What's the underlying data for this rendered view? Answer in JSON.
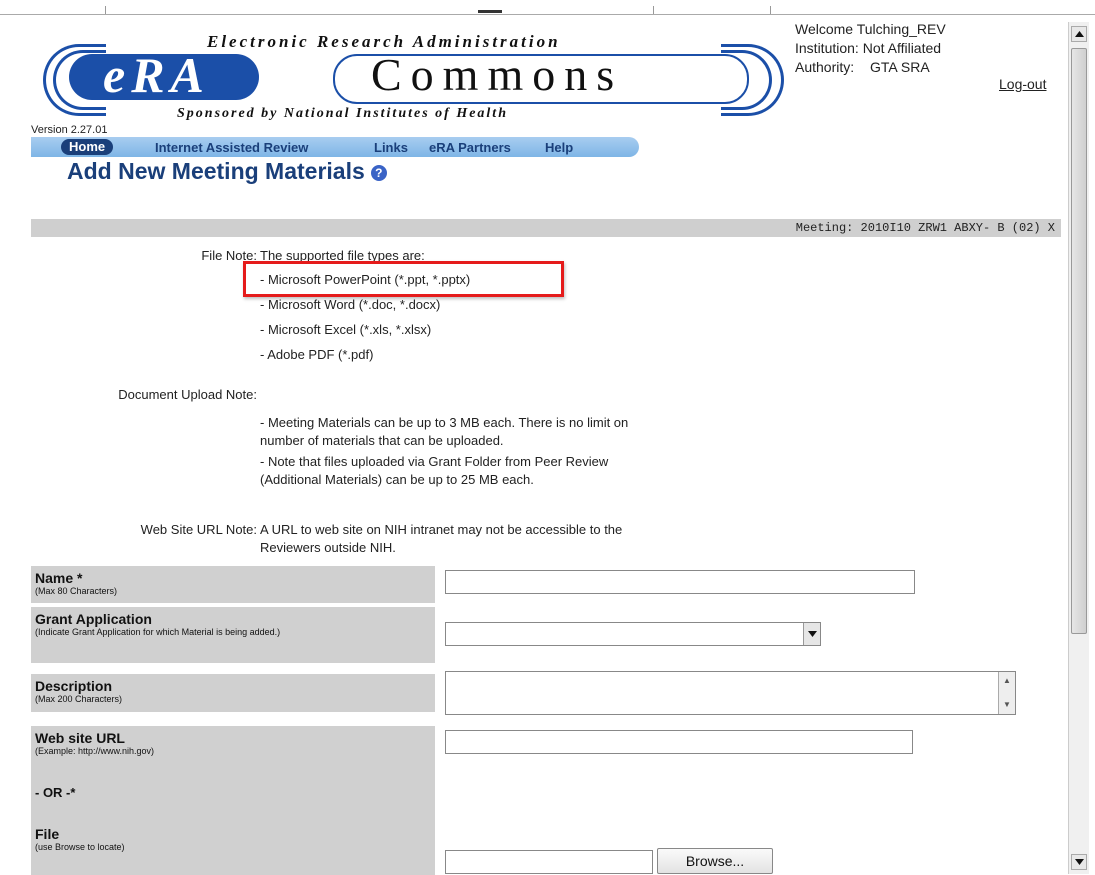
{
  "header": {
    "logo_tagline_top": "Electronic Research Administration",
    "logo_era": "eRA",
    "logo_commons": "Commons",
    "logo_tagline_bottom": "Sponsored by National Institutes of Health",
    "welcome": "Welcome Tulching_REV",
    "institution": "Institution: Not Affiliated",
    "authority_label": "Authority:",
    "authority_role": "GTA SRA",
    "logout": "Log-out",
    "version": "Version 2.27.01"
  },
  "nav": {
    "items": [
      {
        "label": "Home"
      },
      {
        "label": "Internet Assisted Review"
      },
      {
        "label": "Links"
      },
      {
        "label": "eRA Partners"
      },
      {
        "label": "Help"
      }
    ]
  },
  "page": {
    "title": "Add New Meeting Materials",
    "meeting": "Meeting: 2010I10 ZRW1 ABXY- B (02) X"
  },
  "notes": {
    "file_note_label": "File Note:",
    "file_note_intro": "The supported file types are:",
    "file_types": [
      "- Microsoft PowerPoint (*.ppt, *.pptx)",
      "- Microsoft Word (*.doc, *.docx)",
      "- Microsoft Excel (*.xls, *.xlsx)",
      "- Adobe PDF (*.pdf)"
    ],
    "upload_note_label": "Document Upload Note:",
    "upload_lines": [
      "- Meeting Materials can be up to 3 MB each. There is no limit on",
      "number of materials that can be uploaded.",
      "- Note that files uploaded via Grant Folder from Peer Review",
      "(Additional Materials) can be up to 25 MB each."
    ],
    "url_note_label": "Web Site URL Note:",
    "url_lines": [
      "A URL to web site on NIH intranet may not be accessible to the",
      "Reviewers outside NIH."
    ]
  },
  "form": {
    "name_label": "Name *",
    "name_sub": "(Max 80 Characters)",
    "name_value": "",
    "grant_label": "Grant Application",
    "grant_sub": "(Indicate Grant Application for which Material is being added.)",
    "grant_value": "",
    "desc_label": "Description",
    "desc_sub": "(Max 200 Characters)",
    "desc_value": "",
    "url_label": "Web site URL",
    "url_sub": "(Example: http://www.nih.gov)",
    "url_value": "",
    "or_label": "- OR -*",
    "file_label": "File",
    "file_sub": "(use Browse to locate)",
    "file_value": "",
    "browse_label": "Browse..."
  },
  "colors": {
    "highlight": "#e51b1b",
    "title": "#1a3f7a",
    "nav_bg": "#8fc0ea"
  }
}
